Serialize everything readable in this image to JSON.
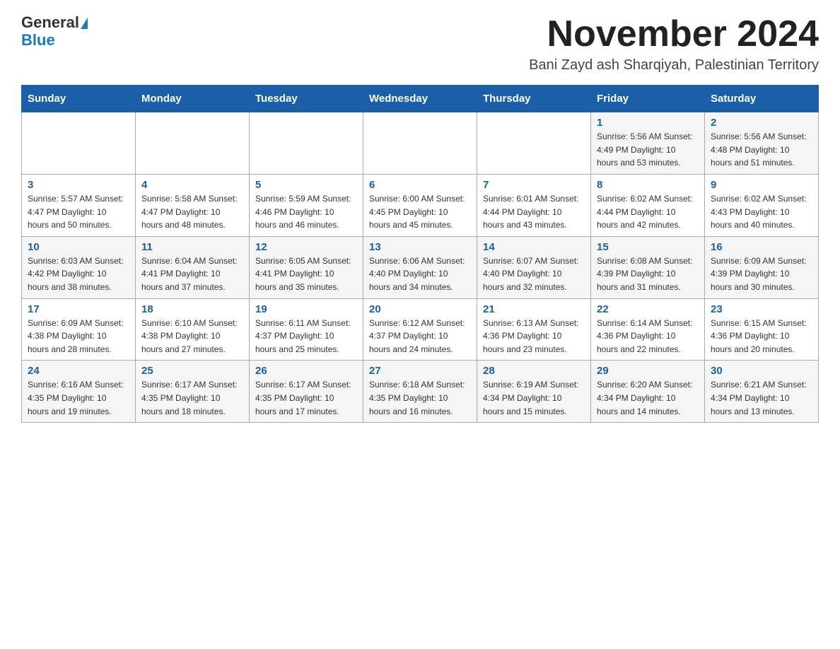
{
  "logo": {
    "general": "General",
    "blue": "Blue"
  },
  "header": {
    "month": "November 2024",
    "location": "Bani Zayd ash Sharqiyah, Palestinian Territory"
  },
  "days_of_week": [
    "Sunday",
    "Monday",
    "Tuesday",
    "Wednesday",
    "Thursday",
    "Friday",
    "Saturday"
  ],
  "weeks": [
    [
      {
        "day": "",
        "info": ""
      },
      {
        "day": "",
        "info": ""
      },
      {
        "day": "",
        "info": ""
      },
      {
        "day": "",
        "info": ""
      },
      {
        "day": "",
        "info": ""
      },
      {
        "day": "1",
        "info": "Sunrise: 5:56 AM\nSunset: 4:49 PM\nDaylight: 10 hours\nand 53 minutes."
      },
      {
        "day": "2",
        "info": "Sunrise: 5:56 AM\nSunset: 4:48 PM\nDaylight: 10 hours\nand 51 minutes."
      }
    ],
    [
      {
        "day": "3",
        "info": "Sunrise: 5:57 AM\nSunset: 4:47 PM\nDaylight: 10 hours\nand 50 minutes."
      },
      {
        "day": "4",
        "info": "Sunrise: 5:58 AM\nSunset: 4:47 PM\nDaylight: 10 hours\nand 48 minutes."
      },
      {
        "day": "5",
        "info": "Sunrise: 5:59 AM\nSunset: 4:46 PM\nDaylight: 10 hours\nand 46 minutes."
      },
      {
        "day": "6",
        "info": "Sunrise: 6:00 AM\nSunset: 4:45 PM\nDaylight: 10 hours\nand 45 minutes."
      },
      {
        "day": "7",
        "info": "Sunrise: 6:01 AM\nSunset: 4:44 PM\nDaylight: 10 hours\nand 43 minutes."
      },
      {
        "day": "8",
        "info": "Sunrise: 6:02 AM\nSunset: 4:44 PM\nDaylight: 10 hours\nand 42 minutes."
      },
      {
        "day": "9",
        "info": "Sunrise: 6:02 AM\nSunset: 4:43 PM\nDaylight: 10 hours\nand 40 minutes."
      }
    ],
    [
      {
        "day": "10",
        "info": "Sunrise: 6:03 AM\nSunset: 4:42 PM\nDaylight: 10 hours\nand 38 minutes."
      },
      {
        "day": "11",
        "info": "Sunrise: 6:04 AM\nSunset: 4:41 PM\nDaylight: 10 hours\nand 37 minutes."
      },
      {
        "day": "12",
        "info": "Sunrise: 6:05 AM\nSunset: 4:41 PM\nDaylight: 10 hours\nand 35 minutes."
      },
      {
        "day": "13",
        "info": "Sunrise: 6:06 AM\nSunset: 4:40 PM\nDaylight: 10 hours\nand 34 minutes."
      },
      {
        "day": "14",
        "info": "Sunrise: 6:07 AM\nSunset: 4:40 PM\nDaylight: 10 hours\nand 32 minutes."
      },
      {
        "day": "15",
        "info": "Sunrise: 6:08 AM\nSunset: 4:39 PM\nDaylight: 10 hours\nand 31 minutes."
      },
      {
        "day": "16",
        "info": "Sunrise: 6:09 AM\nSunset: 4:39 PM\nDaylight: 10 hours\nand 30 minutes."
      }
    ],
    [
      {
        "day": "17",
        "info": "Sunrise: 6:09 AM\nSunset: 4:38 PM\nDaylight: 10 hours\nand 28 minutes."
      },
      {
        "day": "18",
        "info": "Sunrise: 6:10 AM\nSunset: 4:38 PM\nDaylight: 10 hours\nand 27 minutes."
      },
      {
        "day": "19",
        "info": "Sunrise: 6:11 AM\nSunset: 4:37 PM\nDaylight: 10 hours\nand 25 minutes."
      },
      {
        "day": "20",
        "info": "Sunrise: 6:12 AM\nSunset: 4:37 PM\nDaylight: 10 hours\nand 24 minutes."
      },
      {
        "day": "21",
        "info": "Sunrise: 6:13 AM\nSunset: 4:36 PM\nDaylight: 10 hours\nand 23 minutes."
      },
      {
        "day": "22",
        "info": "Sunrise: 6:14 AM\nSunset: 4:36 PM\nDaylight: 10 hours\nand 22 minutes."
      },
      {
        "day": "23",
        "info": "Sunrise: 6:15 AM\nSunset: 4:36 PM\nDaylight: 10 hours\nand 20 minutes."
      }
    ],
    [
      {
        "day": "24",
        "info": "Sunrise: 6:16 AM\nSunset: 4:35 PM\nDaylight: 10 hours\nand 19 minutes."
      },
      {
        "day": "25",
        "info": "Sunrise: 6:17 AM\nSunset: 4:35 PM\nDaylight: 10 hours\nand 18 minutes."
      },
      {
        "day": "26",
        "info": "Sunrise: 6:17 AM\nSunset: 4:35 PM\nDaylight: 10 hours\nand 17 minutes."
      },
      {
        "day": "27",
        "info": "Sunrise: 6:18 AM\nSunset: 4:35 PM\nDaylight: 10 hours\nand 16 minutes."
      },
      {
        "day": "28",
        "info": "Sunrise: 6:19 AM\nSunset: 4:34 PM\nDaylight: 10 hours\nand 15 minutes."
      },
      {
        "day": "29",
        "info": "Sunrise: 6:20 AM\nSunset: 4:34 PM\nDaylight: 10 hours\nand 14 minutes."
      },
      {
        "day": "30",
        "info": "Sunrise: 6:21 AM\nSunset: 4:34 PM\nDaylight: 10 hours\nand 13 minutes."
      }
    ]
  ]
}
